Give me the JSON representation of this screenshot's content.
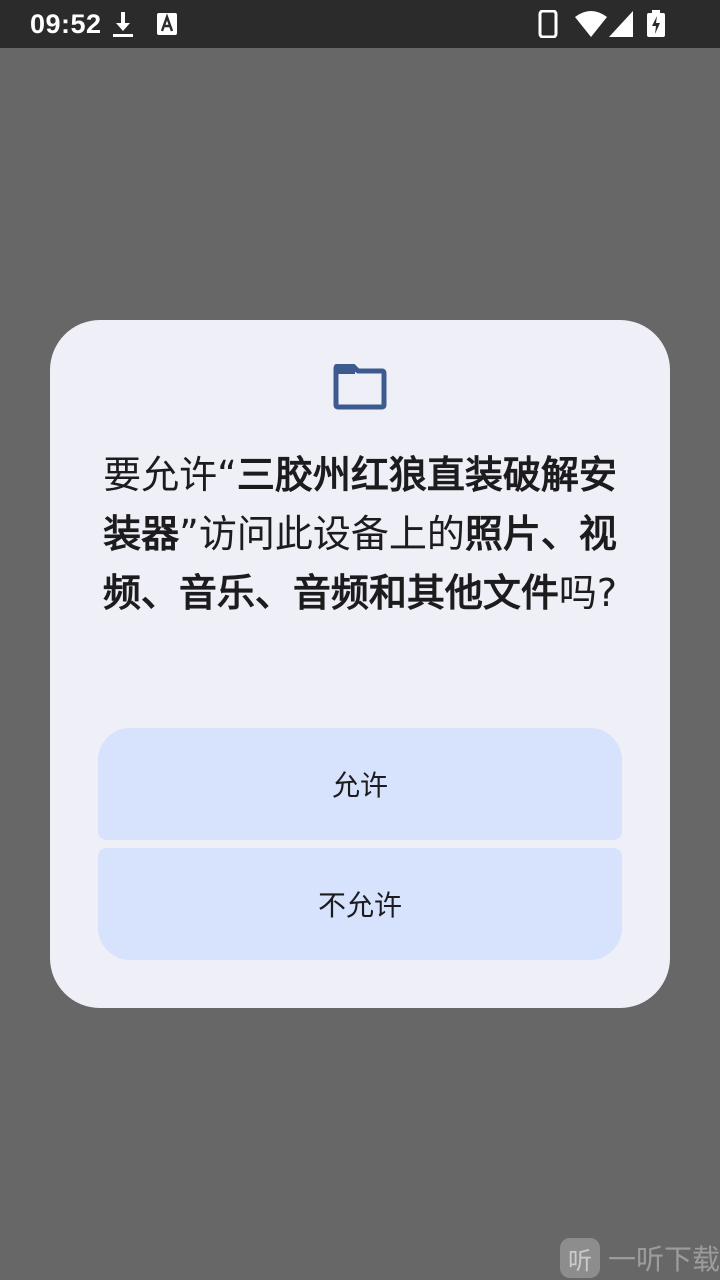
{
  "status_bar": {
    "time": "09:52",
    "icons": [
      "download-icon",
      "text-a-icon",
      "phone-icon",
      "wifi-icon",
      "signal-icon",
      "battery-charging-icon"
    ]
  },
  "dialog": {
    "icon": "folder-icon",
    "message": {
      "part1": "要允许“",
      "app_name": "三胶州红狼直装破解安装器",
      "part2": "”访问此设备上的",
      "files": "照片、视频、音乐、音频和其他文件",
      "part3": "吗?"
    },
    "allow_label": "允许",
    "deny_label": "不允许"
  },
  "watermark": {
    "logo_text": "听",
    "text": "一听下载"
  },
  "colors": {
    "scrim": "#676767",
    "status_bar": "#2b2b2b",
    "dialog_bg": "#eff0f7",
    "button_bg": "#d7e3fd",
    "folder_icon": "#3c5a8f"
  }
}
